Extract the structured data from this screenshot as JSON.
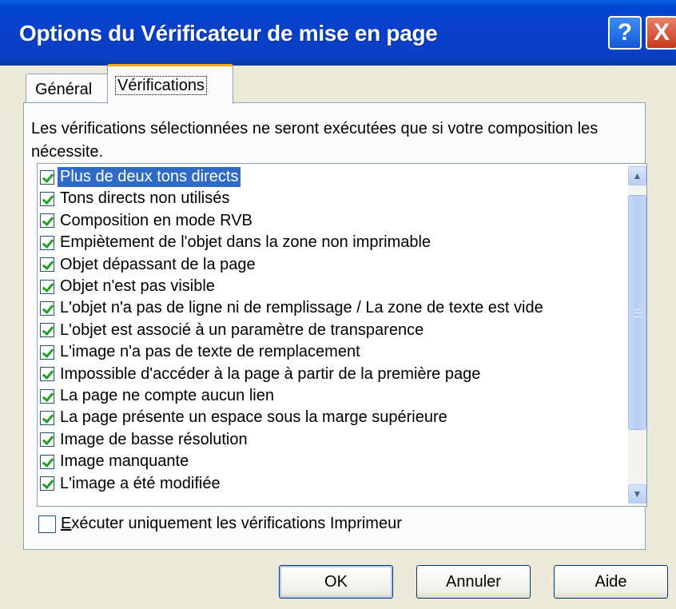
{
  "dialog": {
    "title": "Options du Vérificateur de mise en page",
    "help_icon": "?",
    "close_icon": "X"
  },
  "tabs": [
    {
      "label": "Général",
      "active": false
    },
    {
      "label": "Vérifications",
      "active": true
    }
  ],
  "description": "Les vérifications sélectionnées ne seront exécutées que si votre composition les nécessite.",
  "checks": [
    {
      "label": "Plus de deux tons directs",
      "checked": true,
      "selected": true
    },
    {
      "label": "Tons directs non utilisés",
      "checked": true
    },
    {
      "label": "Composition en mode RVB",
      "checked": true
    },
    {
      "label": "Empiètement de l'objet dans la zone non imprimable",
      "checked": true
    },
    {
      "label": "Objet dépassant de la page",
      "checked": true
    },
    {
      "label": "Objet n'est pas visible",
      "checked": true
    },
    {
      "label": "L'objet n'a pas de ligne ni de remplissage / La zone de texte est vide",
      "checked": true
    },
    {
      "label": "L'objet est associé à un paramètre de transparence",
      "checked": true
    },
    {
      "label": "L'image n'a pas de texte de remplacement",
      "checked": true
    },
    {
      "label": "Impossible d'accéder à la page à partir de la première page",
      "checked": true
    },
    {
      "label": "La page ne compte aucun lien",
      "checked": true
    },
    {
      "label": "La page présente un espace sous la marge supérieure",
      "checked": true
    },
    {
      "label": "Image de basse résolution",
      "checked": true
    },
    {
      "label": "Image manquante",
      "checked": true
    },
    {
      "label": "L'image a été modifiée",
      "checked": true
    }
  ],
  "option": {
    "label_first": "E",
    "label_rest": "xécuter uniquement les vérifications Imprimeur",
    "checked": false
  },
  "buttons": {
    "ok": "OK",
    "cancel": "Annuler",
    "help": "Aide"
  },
  "colors": {
    "titlebar": "#0a40c8",
    "selection": "#316ac5",
    "check": "#21a121",
    "active_tab_accent": "#f2a81a"
  }
}
